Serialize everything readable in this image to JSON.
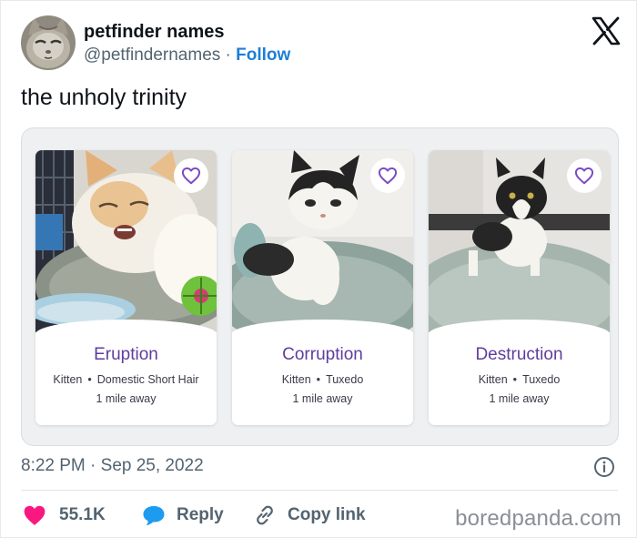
{
  "author": {
    "display_name": "petfinder names",
    "handle": "@petfindernames",
    "separator": "·",
    "follow_label": "Follow"
  },
  "tweet_text": "the unholy trinity",
  "cards": [
    {
      "name": "Eruption",
      "age": "Kitten",
      "dot": "•",
      "breed": "Domestic Short Hair",
      "distance": "1 mile away"
    },
    {
      "name": "Corruption",
      "age": "Kitten",
      "dot": "•",
      "breed": "Tuxedo",
      "distance": "1 mile away"
    },
    {
      "name": "Destruction",
      "age": "Kitten",
      "dot": "•",
      "breed": "Tuxedo",
      "distance": "1 mile away"
    }
  ],
  "timestamp": "8:22 PM · Sep 25, 2022",
  "actions": {
    "likes": "55.1K",
    "reply_label": "Reply",
    "copy_link_label": "Copy link"
  },
  "watermark": "boredpanda.com",
  "colors": {
    "like_heart": "#f91880",
    "reply_bubble": "#1d9bf0",
    "follow_link": "#1d7ed6",
    "pet_name": "#5f3d9e",
    "favorite_heart": "#7a4cc0"
  },
  "icons": {
    "logo": "x-logo-icon",
    "info": "info-icon",
    "like": "heart-icon",
    "reply": "speech-bubble-icon",
    "copy_link": "link-icon",
    "favorite": "heart-outline-icon"
  }
}
